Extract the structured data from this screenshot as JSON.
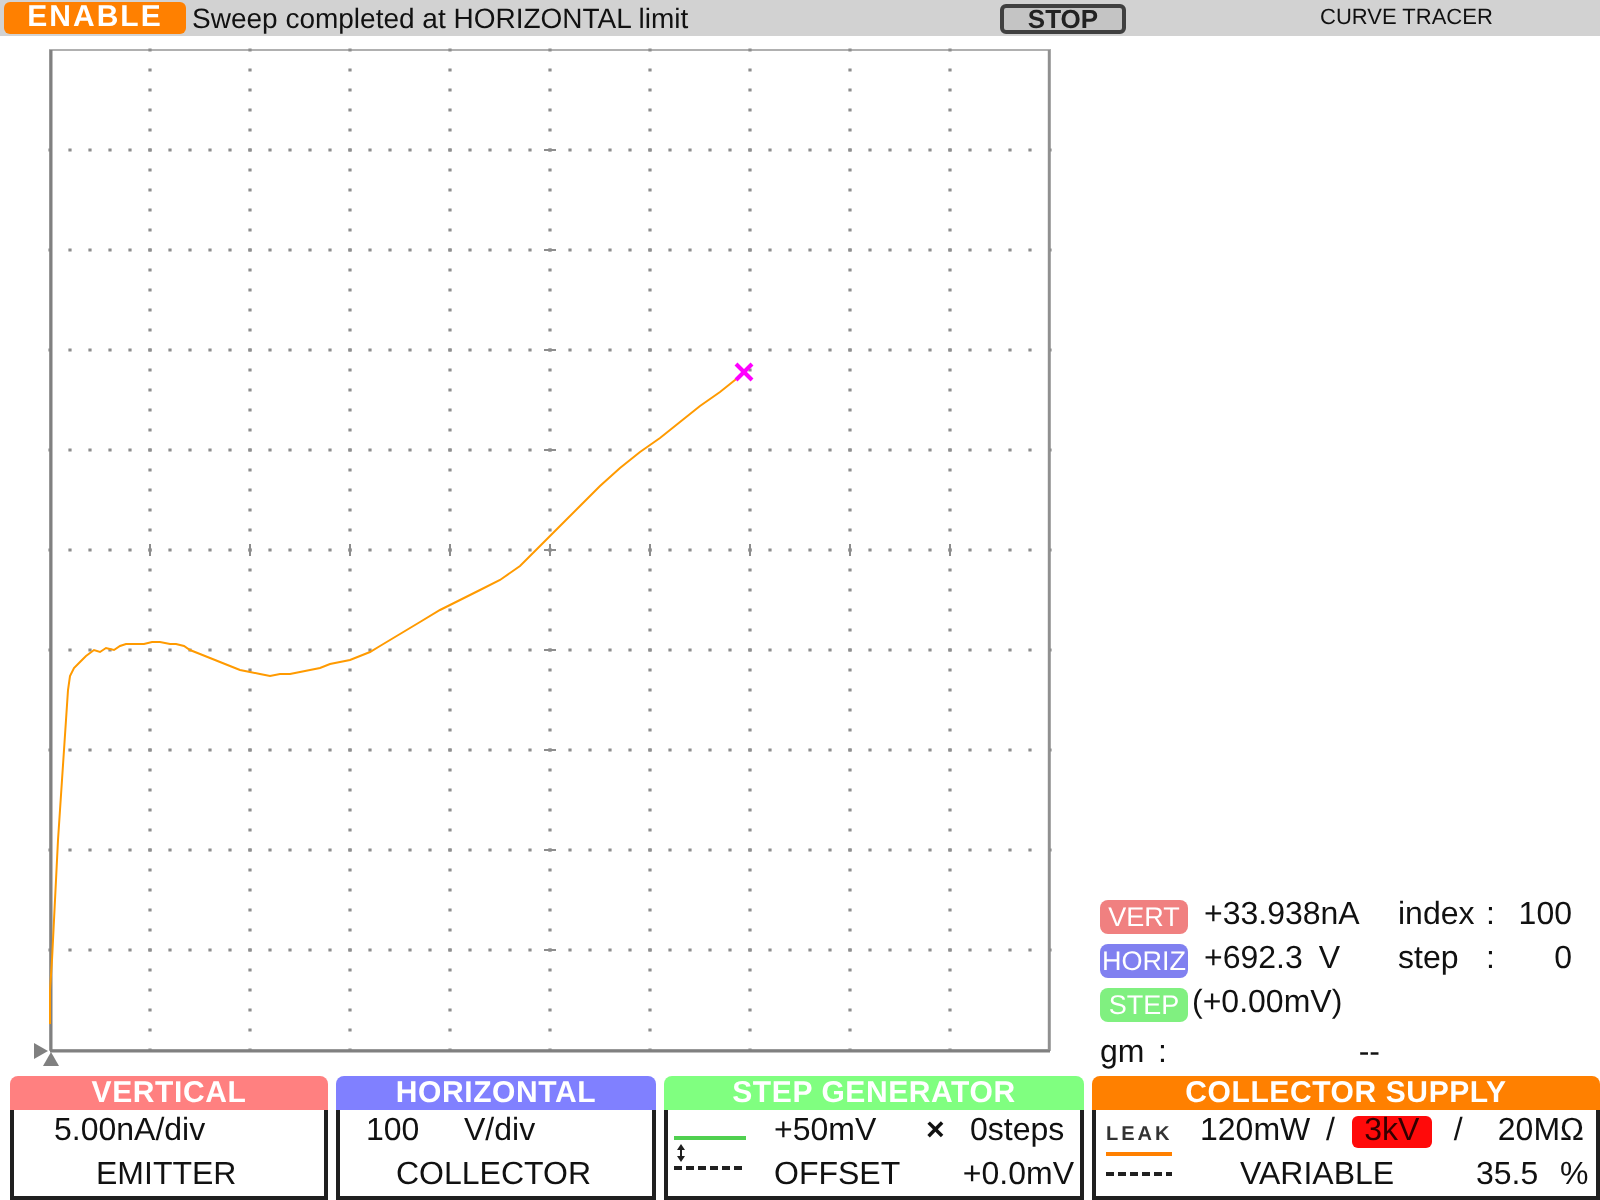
{
  "status": {
    "label": "ENABLE"
  },
  "message": "Sweep completed at HORIZONTAL limit",
  "stop_button": {
    "label": "STOP"
  },
  "title": "CURVE TRACER",
  "readouts": [
    {
      "kind": "channel",
      "badge": "VERT",
      "color": "#f08080",
      "value": "+33.938nA",
      "label": "index",
      "separator": ":",
      "reading": "100"
    },
    {
      "kind": "channel",
      "badge": "HORIZ",
      "color": "#8080f0",
      "value": "+692.3",
      "unit": "V",
      "label": "step",
      "separator": ":",
      "reading": "0"
    },
    {
      "kind": "channel",
      "badge": "STEP",
      "color": "#80f080",
      "value": "(+0.00mV)"
    },
    {
      "kind": "param",
      "name": "gm",
      "separator": ":",
      "value": "--"
    }
  ],
  "panels": [
    {
      "kind": "vertical",
      "title": "VERTICAL",
      "color": "#ff8080",
      "scale": "5.00nA/div",
      "source": "EMITTER"
    },
    {
      "kind": "horizontal",
      "title": "HORIZONTAL",
      "color": "#8080ff",
      "scale_value": "100",
      "scale_unit": "V/div",
      "source": "COLLECTOR"
    },
    {
      "kind": "step",
      "title": "STEP GENERATOR",
      "color": "#80ff80",
      "amplitude": "+50mV",
      "times": "×",
      "steps": "0steps",
      "offset_label": "OFFSET",
      "offset": "+0.0mV"
    },
    {
      "kind": "collector",
      "title": "COLLECTOR SUPPLY",
      "color": "#ff8000",
      "mode": "LEAK",
      "power": "120mW",
      "separator": "/",
      "voltage": "3kV",
      "voltage_alert": true,
      "resistance": "20MΩ",
      "supply": "VARIABLE",
      "percent": "35.5",
      "percent_unit": "%"
    }
  ]
}
